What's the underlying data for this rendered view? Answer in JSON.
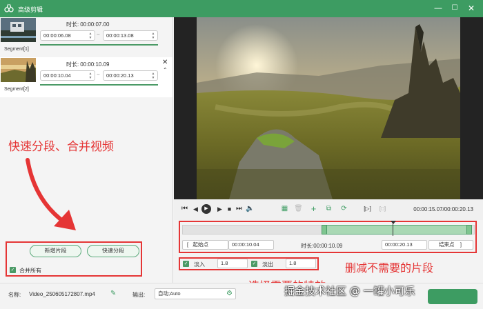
{
  "window": {
    "title": "高级剪辑",
    "min_icon": "minimize-icon",
    "max_icon": "maximize-icon",
    "close_icon": "close-icon"
  },
  "segments": [
    {
      "label": "Segment[1]",
      "duration_label": "时长:",
      "duration": "00:00:07.00",
      "start": "00:00:06.08",
      "end": "00:00:13.08",
      "tilde": "~"
    },
    {
      "label": "Segment[2]",
      "duration_label": "时长:",
      "duration": "00:00:10.09",
      "start": "00:00:10.04",
      "end": "00:00:20.13",
      "tilde": "~"
    }
  ],
  "annotations": {
    "split_merge": "快速分段、合并视频",
    "delete_unneeded": "删减不需要的片段",
    "choose_effects": "选择需要的特效"
  },
  "buttons": {
    "add_segment": "新增片段",
    "quick_split": "快速分段",
    "merge_all": "合并所有"
  },
  "player": {
    "time_readout": "00:00:15.07/00:00:20.13"
  },
  "timeline": {
    "start_label": "起始点",
    "start_value": "00:00:10.04",
    "duration_label": "时长:",
    "duration_value": "00:00:10.09",
    "end_value": "00:00:20.13",
    "end_label": "结束点",
    "bracket_left": "[",
    "bracket_right": "]"
  },
  "effects": {
    "fade_in_label": "淡入",
    "fade_in_value": "1.8",
    "fade_out_label": "淡出",
    "fade_out_value": "1.8"
  },
  "bottom": {
    "name_label": "名称:",
    "file_name": "Video_250605172807.mp4",
    "output_label": "输出:",
    "output_value": "自动;Auto"
  },
  "watermark": "掘金技术社区 @ 一罐小可乐",
  "colors": {
    "brand_green": "#3d9c62",
    "annotation_red": "#e53535"
  }
}
